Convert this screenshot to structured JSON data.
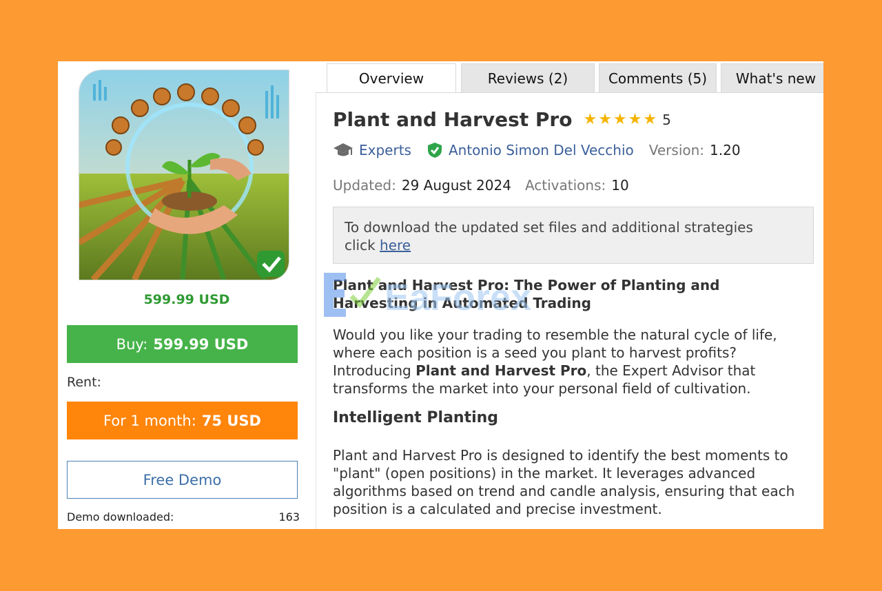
{
  "colors": {
    "background": "#fd9a32",
    "buy": "#46b34a",
    "rent": "#ff850b",
    "price": "#2f9a32",
    "link": "#3b5f9a",
    "star": "#f4b400"
  },
  "sidebar": {
    "price": "599.99 USD",
    "buy_prefix": "Buy:",
    "buy_amount": "599.99 USD",
    "rent_label": "Rent:",
    "rent_prefix": "For 1 month:",
    "rent_amount": "75 USD",
    "demo_label": "Free Demo",
    "demo_downloaded_label": "Demo downloaded:",
    "demo_downloaded_count": "163"
  },
  "tabs": [
    {
      "label": "Overview",
      "active": true
    },
    {
      "label": "Reviews (2)"
    },
    {
      "label": "Comments (5)"
    },
    {
      "label": "What's new"
    }
  ],
  "product": {
    "title": "Plant and Harvest Pro",
    "rating": "5",
    "stars": 5,
    "category": "Experts",
    "author": "Antonio Simon Del Vecchio",
    "version_label": "Version:",
    "version": "1.20",
    "updated_label": "Updated:",
    "updated": "29 August 2024",
    "activations_label": "Activations:",
    "activations": "10"
  },
  "notice": {
    "text": "To download the updated set files and additional strategies",
    "prefix": "click",
    "link": "here"
  },
  "description": {
    "heading": "Plant and Harvest Pro: The Power of Planting and Harvesting in Automated Trading",
    "p1_a": "Would you like your trading to resemble the natural cycle of life, where each position is a seed you plant to harvest profits? Introducing ",
    "p1_bold": "Plant and Harvest Pro",
    "p1_b": ", the Expert Advisor that transforms the market into your personal field of cultivation.",
    "section_title": "Intelligent Planting",
    "p2": "Plant and Harvest Pro is designed to identify the best moments to \"plant\" (open positions) in the market. It leverages advanced algorithms based on trend and candle analysis, ensuring that each position is a calculated and precise investment."
  },
  "watermark": {
    "text": "EaForex"
  }
}
